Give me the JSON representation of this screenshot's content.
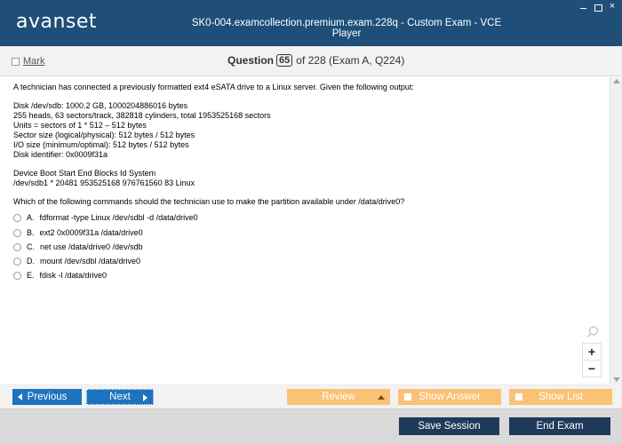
{
  "app": {
    "logo_text": "avanset",
    "window_title": "SK0-004.examcollection.premium.exam.228q - Custom Exam - VCE Player",
    "close_glyph": "×"
  },
  "header": {
    "mark_label": "Mark",
    "question_word": "Question",
    "question_number": "65",
    "question_suffix": "of 228 (Exam A, Q224)"
  },
  "question": {
    "lines": [
      "A technician has connected a previously formatted ext4 eSATA drive to a Linux server. Given the following output:",
      "Disk /dev/sdb: 1000.2 GB, 1000204886016 bytes",
      "255 heads, 63 sectors/track, 382818 cylinders, total 1953525168 sectors",
      "Units = sectors of 1 * 512 – 512 bytes",
      "Sector size (logical/physical): 512 bytes / 512 bytes",
      "I/O size (minimum/optimal): 512 bytes / 512 bytes",
      "Disk identifier: 0x0009f31a",
      "Device Boot Start End Blocks Id System",
      "/dev/sdb1 * 20481 953525168 976761560 83 Linux",
      "Which of the following commands should the technician use to make the partition available under /data/drive0?"
    ],
    "options": [
      {
        "letter": "A.",
        "text": "fdformat -type Linux /dev/sdbl -d /data/drive0"
      },
      {
        "letter": "B.",
        "text": "ext2 0x0009f31a /data/drive0"
      },
      {
        "letter": "C.",
        "text": "net use /data/drive0 /dev/sdb"
      },
      {
        "letter": "D.",
        "text": "mount /dev/sdbl /data/drive0"
      },
      {
        "letter": "E.",
        "text": "fdisk -l /data/drive0"
      }
    ]
  },
  "zoom": {
    "plus": "+",
    "minus": "−"
  },
  "nav": {
    "previous": "Previous",
    "next": "Next",
    "review": "Review",
    "show_answer": "Show Answer",
    "show_list": "Show List"
  },
  "footer": {
    "save_session": "Save Session",
    "end_exam": "End Exam"
  },
  "colors": {
    "titlebar": "#1f4e79",
    "nav_blue": "#1e73be",
    "nav_orange": "#fbc175",
    "footer_button": "#1f3a5a"
  }
}
